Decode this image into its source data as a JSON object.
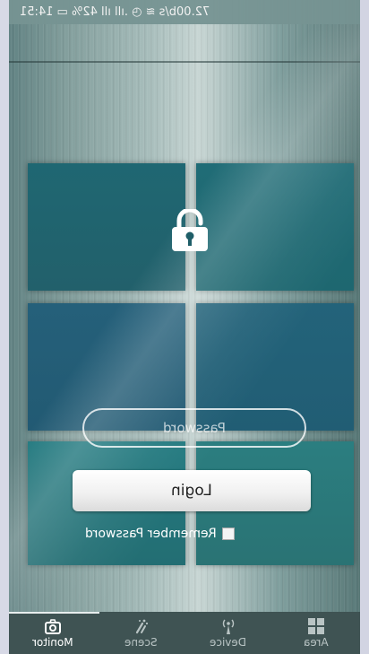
{
  "status_bar": {
    "text": "72.00b/s ≋ ◷ .ıll ıll 42% ▭ 14:51"
  },
  "login": {
    "password_placeholder": "Password",
    "login_label": "Login",
    "remember_label": "Remember Password",
    "remember_checked": false
  },
  "tabs": [
    {
      "label": "Monitor",
      "icon": "camera-icon",
      "active": true
    },
    {
      "label": "Scene",
      "icon": "scene-icon",
      "active": false
    },
    {
      "label": "Device",
      "icon": "device-antenna-icon",
      "active": false
    },
    {
      "label": "Area",
      "icon": "grid-icon",
      "active": false
    }
  ],
  "colors": {
    "tile_teal": "#1f6772",
    "tab_bar": "#3f5353",
    "button": "#f1f1f1"
  }
}
